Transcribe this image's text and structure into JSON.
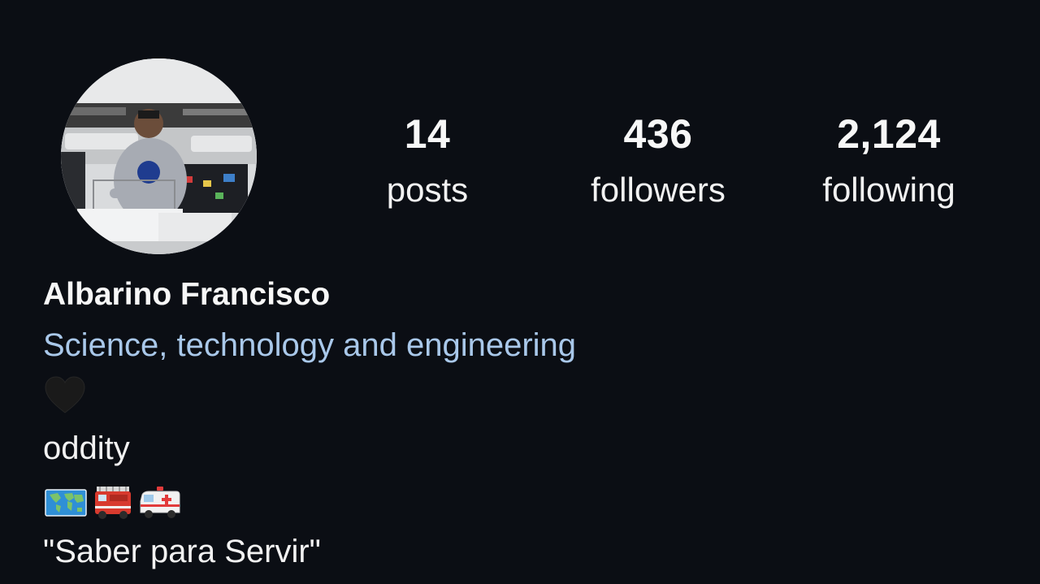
{
  "profile": {
    "name": "Albarino Francisco",
    "category": "Science, technology and engineering",
    "bio_line1": "oddity",
    "motto": "\"Saber para Servir\""
  },
  "stats": {
    "posts": {
      "count": "14",
      "label": "posts"
    },
    "followers": {
      "count": "436",
      "label": "followers"
    },
    "following": {
      "count": "2,124",
      "label": "following"
    }
  },
  "icons": {
    "heart": "black-heart-icon",
    "emojis": [
      "world-map-icon",
      "fire-engine-icon",
      "ambulance-icon"
    ]
  },
  "colors": {
    "background": "#0b0e14",
    "category_link": "#a9c8ea",
    "text": "#f5f5f5"
  }
}
